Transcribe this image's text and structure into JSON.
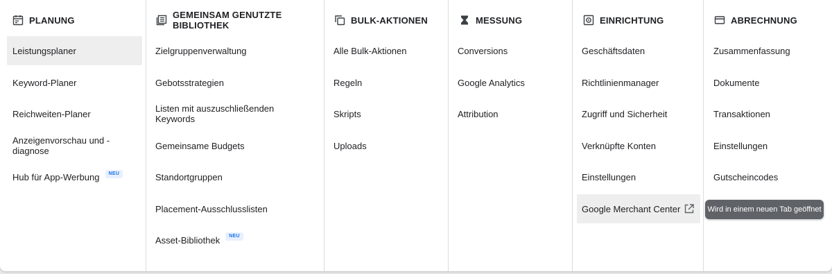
{
  "columns": [
    {
      "title": "PLANUNG",
      "icon": "calendar-icon",
      "items": [
        {
          "label": "Leistungsplaner"
        },
        {
          "label": "Keyword-Planer"
        },
        {
          "label": "Reichweiten-Planer"
        },
        {
          "label": "Anzeigenvorschau und -diagnose"
        },
        {
          "label": "Hub für App-Werbung",
          "badge": "NEU"
        }
      ]
    },
    {
      "title": "GEMEINSAM GENUTZTE BIBLIOTHEK",
      "icon": "library-icon",
      "items": [
        {
          "label": "Zielgruppenverwaltung"
        },
        {
          "label": "Gebotsstrategien"
        },
        {
          "label": "Listen mit auszuschließenden Keywords"
        },
        {
          "label": "Gemeinsame Budgets"
        },
        {
          "label": "Standortgruppen"
        },
        {
          "label": "Placement-Ausschlusslisten"
        },
        {
          "label": "Asset-Bibliothek",
          "badge": "NEU"
        }
      ]
    },
    {
      "title": "BULK-AKTIONEN",
      "icon": "copy-icon",
      "items": [
        {
          "label": "Alle Bulk-Aktionen"
        },
        {
          "label": "Regeln"
        },
        {
          "label": "Skripts"
        },
        {
          "label": "Uploads"
        }
      ]
    },
    {
      "title": "MESSUNG",
      "icon": "hourglass-icon",
      "items": [
        {
          "label": "Conversions"
        },
        {
          "label": "Google Analytics"
        },
        {
          "label": "Attribution"
        }
      ]
    },
    {
      "title": "EINRICHTUNG",
      "icon": "settings-icon",
      "items": [
        {
          "label": "Geschäftsdaten"
        },
        {
          "label": "Richtlinienmanager"
        },
        {
          "label": "Zugriff und Sicherheit"
        },
        {
          "label": "Verknüpfte Konten"
        },
        {
          "label": "Einstellungen"
        },
        {
          "label": "Google Merchant Center",
          "external_icon": "open-in-new-icon"
        }
      ]
    },
    {
      "title": "ABRECHNUNG",
      "icon": "credit-card-icon",
      "items": [
        {
          "label": "Zusammenfassung"
        },
        {
          "label": "Dokumente"
        },
        {
          "label": "Transaktionen"
        },
        {
          "label": "Einstellungen"
        },
        {
          "label": "Gutscheincodes"
        }
      ]
    }
  ],
  "tooltip": "Wird in einem neuen Tab geöffnet",
  "colors": {
    "badge_text": "#1a73e8",
    "badge_bg": "#e8f0fe",
    "tooltip_bg": "#5f6368",
    "active_bg": "#eeeeee",
    "divider": "#dadce0"
  }
}
